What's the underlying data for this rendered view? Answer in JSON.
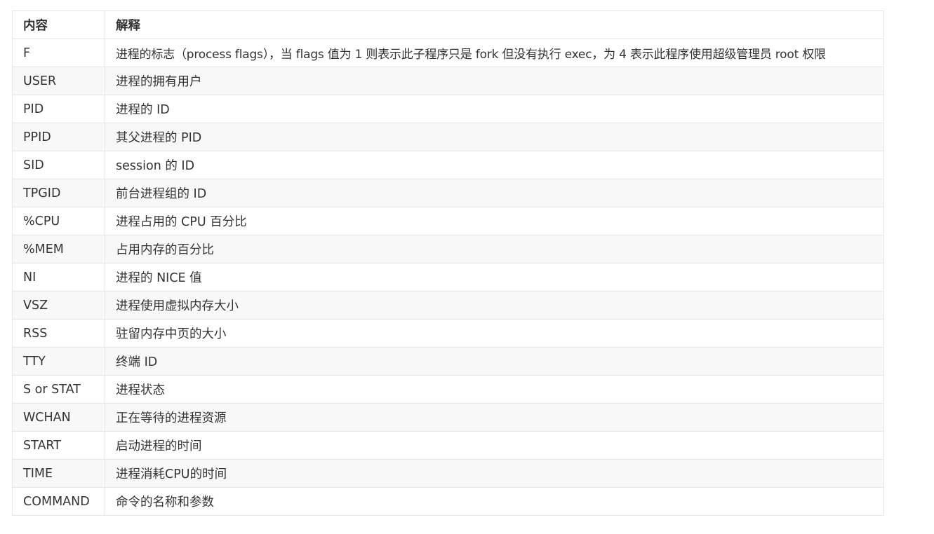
{
  "table": {
    "headers": [
      "内容",
      "解释"
    ],
    "rows": [
      [
        "F",
        "进程的标志（process flags），当 flags 值为 1 则表示此子程序只是 fork 但没有执行 exec，为 4 表示此程序使用超级管理员 root 权限"
      ],
      [
        "USER",
        "进程的拥有用户"
      ],
      [
        "PID",
        "进程的 ID"
      ],
      [
        "PPID",
        "其父进程的 PID"
      ],
      [
        "SID",
        "session 的 ID"
      ],
      [
        "TPGID",
        "前台进程组的 ID"
      ],
      [
        "%CPU",
        "进程占用的 CPU 百分比"
      ],
      [
        "%MEM",
        "占用内存的百分比"
      ],
      [
        "NI",
        "进程的 NICE 值"
      ],
      [
        "VSZ",
        "进程使用虚拟内存大小"
      ],
      [
        "RSS",
        "驻留内存中页的大小"
      ],
      [
        "TTY",
        "终端 ID"
      ],
      [
        "S or STAT",
        "进程状态"
      ],
      [
        "WCHAN",
        "正在等待的进程资源"
      ],
      [
        "START",
        "启动进程的时间"
      ],
      [
        "TIME",
        "进程消耗CPU的时间"
      ],
      [
        "COMMAND",
        "命令的名称和参数"
      ]
    ]
  },
  "colors": {
    "border": "#e6e6e6",
    "stripe": "#f8f8f8",
    "text": "#333333"
  }
}
